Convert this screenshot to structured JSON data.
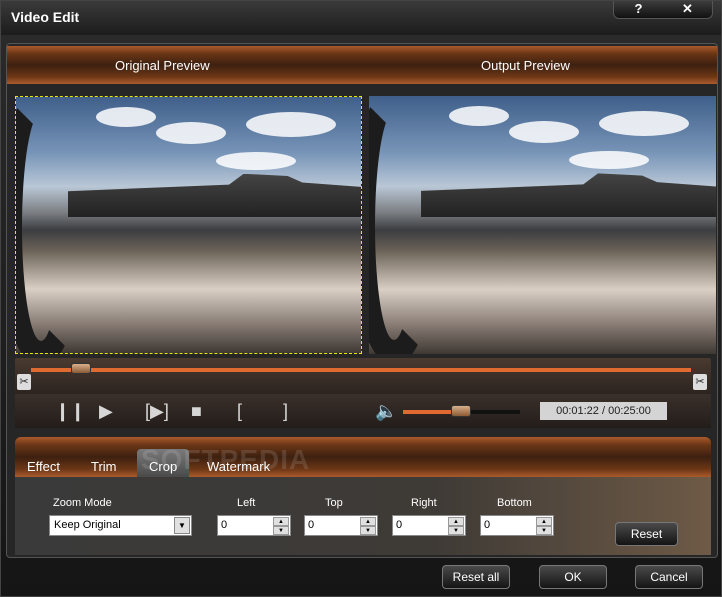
{
  "window": {
    "title": "Video Edit",
    "help_label": "?",
    "close_label": "✕"
  },
  "preview": {
    "original_label": "Original Preview",
    "output_label": "Output Preview"
  },
  "playback": {
    "time": "00:01:22 / 00:25:00",
    "progress": 0.06,
    "volume": 0.45
  },
  "tabs": [
    {
      "label": "Effect"
    },
    {
      "label": "Trim"
    },
    {
      "label": "Crop"
    },
    {
      "label": "Watermark"
    }
  ],
  "active_tab": "Crop",
  "crop": {
    "zoom_mode_label": "Zoom Mode",
    "zoom_mode_value": "Keep Original",
    "left_label": "Left",
    "left_value": "0",
    "top_label": "Top",
    "top_value": "0",
    "right_label": "Right",
    "right_value": "0",
    "bottom_label": "Bottom",
    "bottom_value": "0",
    "reset_label": "Reset"
  },
  "footer": {
    "reset_all_label": "Reset all",
    "ok_label": "OK",
    "cancel_label": "Cancel"
  },
  "watermark_text": "SOFTPEDIA",
  "colors": {
    "accent": "#e06a30",
    "header_brown": "#6b3616"
  }
}
